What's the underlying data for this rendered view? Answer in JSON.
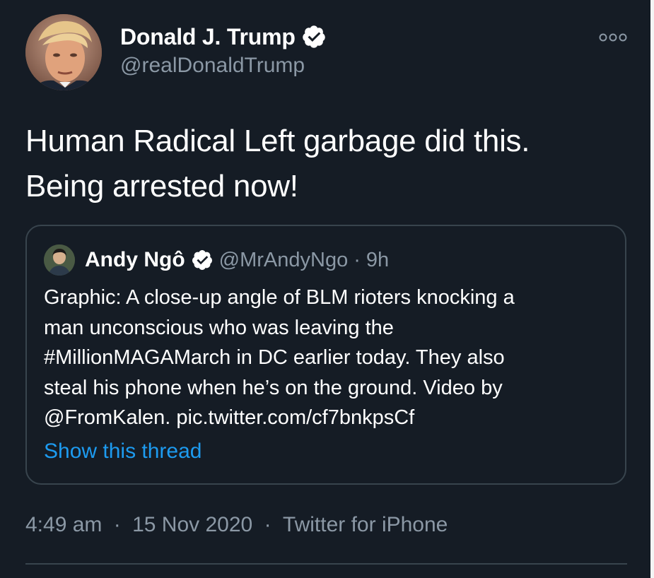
{
  "tweet": {
    "author": {
      "name": "Donald J. Trump",
      "handle": "@realDonaldTrump",
      "verified": true
    },
    "text_line1": "Human Radical Left garbage did this.",
    "text_line2": "Being arrested now!",
    "more_icon": "more-dots-icon",
    "quoted": {
      "author_name": "Andy Ngô",
      "handle": "@MrAndyNgo",
      "separator": "·",
      "time": "9h",
      "verified": true,
      "body_lines": [
        "Graphic: A close-up angle of BLM rioters knocking a",
        "man unconscious who was leaving the",
        "#MillionMAGAMarch in DC earlier today. They also",
        "steal his phone when he’s on the ground. Video by",
        "@FromKalen. pic.twitter.com/cf7bnkpsCf"
      ],
      "show_thread": "Show this thread"
    },
    "meta": {
      "time": "4:49 am",
      "separator": "·",
      "date": "15 Nov 2020",
      "source": "Twitter for iPhone"
    }
  },
  "colors": {
    "background": "#151c25",
    "text_primary": "#ffffff",
    "text_secondary": "#8b98a5",
    "link": "#1d9bf0",
    "border": "#38444d"
  }
}
